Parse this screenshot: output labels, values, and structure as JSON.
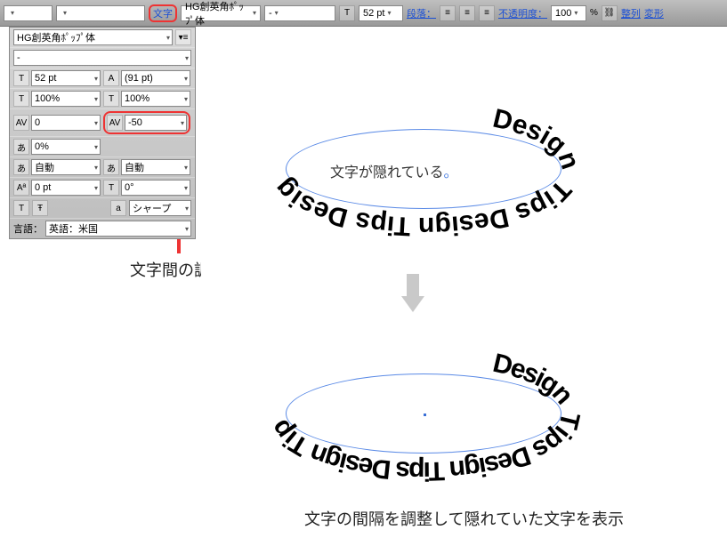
{
  "toolbar": {
    "menu_char": "文字",
    "font_family": "HG創英角ﾎﾟｯﾌﾟ体",
    "font_style": "-",
    "font_size": "52 pt",
    "paragraph_label": "段落：",
    "opacity_label": "不透明度：",
    "opacity_value": "100",
    "opacity_pct": "%",
    "align_label": "整列",
    "transform_label": "変形"
  },
  "panel": {
    "font_family": "HG創英角ﾎﾟｯﾌﾟ体",
    "font_style": "-",
    "size": "52 pt",
    "leading": "(91 pt)",
    "h_scale": "100%",
    "v_scale": "100%",
    "kerning": "0",
    "tracking": "-50",
    "tsume": "0%",
    "baseline": "自動",
    "aki": "自動",
    "baseline_shift": "0 pt",
    "rotation": "0°",
    "t_bold": "T",
    "t_faux": "Ŧ",
    "aa_icon": "a",
    "aa_value": "シャープ",
    "lang_label": "言語：",
    "lang_value": "英語：米国"
  },
  "annotations": {
    "arrow_label": "文字間の調整",
    "hidden_text": "文字が隠れている",
    "bottom_caption": "文字の間隔を調整して隠れていた文字を表示"
  },
  "path_text": {
    "sample": "Design Tips Design Tips Design Tips Design"
  }
}
